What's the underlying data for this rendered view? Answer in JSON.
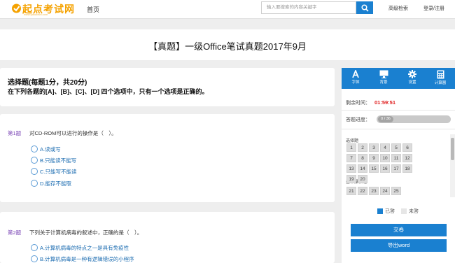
{
  "header": {
    "logo_text": "起点考试网",
    "logo_sub": "www.qdkaoshi.com",
    "nav_home": "首页",
    "search_placeholder": "输入要搜索的内容关键字",
    "adv_search": "高级检索",
    "login": "登录/注册"
  },
  "title": "【真题】一级Office笔试真题2017年9月",
  "section": {
    "heading": "选择题(每题1分，共20分)",
    "instruction": "在下列各题的[A]、[B]、[C]、[D] 四个选项中，只有一个选项是正确的。"
  },
  "questions": [
    {
      "num": "第1题",
      "text": "对CD-ROM可以进行的操作是（　）。",
      "options": [
        "A.读或写",
        "B.只能读不能写",
        "C.只能写不能读",
        "D.能存不能取"
      ]
    },
    {
      "num": "第2题",
      "text": "下列关于计算机病毒的叙述中，正确的是（　）。",
      "options": [
        "A.计算机病毒的特点之一是具有免疫性",
        "B.计算机病毒是一种有逻辑错误的小程序"
      ]
    }
  ],
  "tools": [
    {
      "label": "字体",
      "icon": "font-icon"
    },
    {
      "label": "背景",
      "icon": "monitor-icon"
    },
    {
      "label": "设置",
      "icon": "gear-icon"
    },
    {
      "label": "计算器",
      "icon": "calculator-icon"
    }
  ],
  "panel": {
    "timer_label": "剩余时间：",
    "timer_value": "01:59:51",
    "progress_label": "答题进度：",
    "progress_text": "0 / 36",
    "progress_fraction": 0,
    "section1_label": "选择题",
    "section1_numbers": [
      "1",
      "2",
      "3",
      "4",
      "5",
      "6",
      "7",
      "8",
      "9",
      "10",
      "11",
      "12",
      "13",
      "14",
      "15",
      "16",
      "17",
      "18",
      "19",
      "20"
    ],
    "section2_label": "基本操作题",
    "section2_numbers": [
      "21",
      "22",
      "23",
      "24",
      "25"
    ],
    "legend_answered": "已答",
    "legend_unanswered": "未答",
    "submit_label": "交卷",
    "export_label": "导出word"
  },
  "colors": {
    "accent": "#1a80d0",
    "logo": "#f5a200",
    "timer": "#e02020",
    "question_num": "#7b46b6",
    "option_text": "#1a6bb0"
  }
}
